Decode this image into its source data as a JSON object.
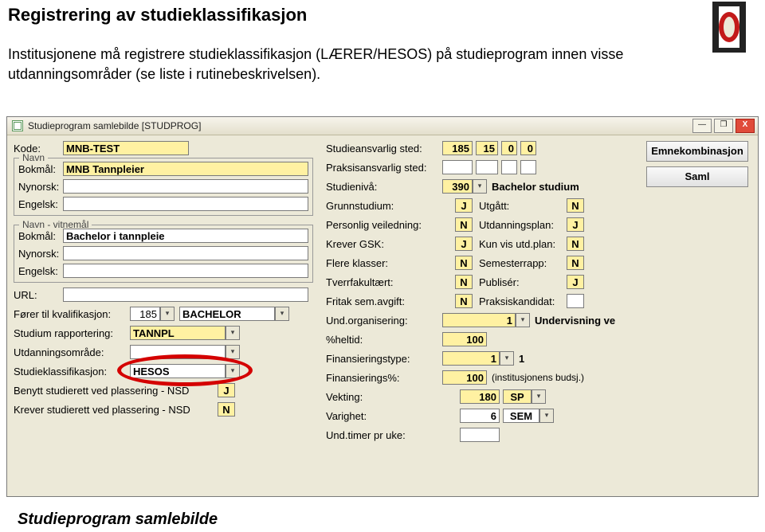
{
  "page": {
    "title": "Registrering av studieklassifikasjon",
    "intro": "Institusjonene må registrere studieklassifikasjon (LÆRER/HESOS) på studieprogram innen visse utdanningsområder (se liste i rutinebeskrivelsen).",
    "footer": "Studieprogram samlebilde"
  },
  "window": {
    "title": "Studieprogram samlebilde   [STUDPROG]",
    "controls": {
      "min": "—",
      "max": "❐",
      "close": "X"
    }
  },
  "left": {
    "kode": {
      "label": "Kode:",
      "value": "MNB-TEST"
    },
    "navn_legend": "Navn",
    "bokmal": {
      "label": "Bokmål:",
      "value": "MNB Tannpleier"
    },
    "nynorsk": {
      "label": "Nynorsk:",
      "value": ""
    },
    "engelsk": {
      "label": "Engelsk:",
      "value": ""
    },
    "vitnemal_legend": "Navn - vitnemål",
    "vitnemal_bokmal": {
      "label": "Bokmål:",
      "value": "Bachelor i tannpleie"
    },
    "vitnemal_nynorsk": {
      "label": "Nynorsk:",
      "value": ""
    },
    "vitnemal_engelsk": {
      "label": "Engelsk:",
      "value": ""
    },
    "url": {
      "label": "URL:",
      "value": ""
    },
    "kvalifikasjon": {
      "label": "Fører til kvalifikasjon:",
      "value": "185",
      "name": "BACHELOR"
    },
    "rapportering": {
      "label": "Studium rapportering:",
      "value": "TANNPL"
    },
    "utdanningsomrade": {
      "label": "Utdanningsområde:",
      "value": ""
    },
    "studieklassifikasjon": {
      "label": "Studieklassifikasjon:",
      "value": "HESOS"
    },
    "benytt_nsd": {
      "label": "Benytt studierett ved plassering - NSD",
      "value": "J"
    },
    "krever_nsd": {
      "label": "Krever studierett ved plassering - NSD",
      "value": "N"
    }
  },
  "mid": {
    "studieansvarlig": {
      "label": "Studieansvarlig sted:",
      "v1": "185",
      "v2": "15",
      "v3": "0",
      "v4": "0"
    },
    "praksisansvarlig": {
      "label": "Praksisansvarlig sted:",
      "v1": "",
      "v2": "",
      "v3": "",
      "v4": ""
    },
    "studieniva": {
      "label": "Studienivå:",
      "value": "390",
      "name": "Bachelor studium"
    },
    "grunnstudium": {
      "label": "Grunnstudium:",
      "value": "J"
    },
    "utgatt": {
      "label": "Utgått:",
      "value": "N"
    },
    "personlig": {
      "label": "Personlig veiledning:",
      "value": "N"
    },
    "utdanningsplan": {
      "label": "Utdanningsplan:",
      "value": "J"
    },
    "krever_gsk": {
      "label": "Krever GSK:",
      "value": "J"
    },
    "kun_vis": {
      "label": "Kun vis utd.plan:",
      "value": "N"
    },
    "flere_klasser": {
      "label": "Flere klasser:",
      "value": "N"
    },
    "semesterrapp": {
      "label": "Semesterrapp:",
      "value": "N"
    },
    "tverrfakultert": {
      "label": "Tverrfakultært:",
      "value": "N"
    },
    "publiser": {
      "label": "Publisér:",
      "value": "J"
    },
    "fritak": {
      "label": "Fritak sem.avgift:",
      "value": "N"
    },
    "praksiskandidat": {
      "label": "Praksiskandidat:",
      "value": ""
    },
    "und_org": {
      "label": "Und.organisering:",
      "value": "1",
      "name": "Undervisning ve"
    },
    "heltid": {
      "label": "%heltid:",
      "value": "100"
    },
    "finanstype": {
      "label": "Finansieringstype:",
      "value": "1",
      "extra": "1"
    },
    "finanspct": {
      "label": "Finansierings%:",
      "value": "100",
      "extra": "(institusjonens budsj.)"
    },
    "vekting": {
      "label": "Vekting:",
      "value": "180",
      "unit": "SP"
    },
    "varighet": {
      "label": "Varighet:",
      "value": "6",
      "unit": "SEM"
    },
    "und_timer": {
      "label": "Und.timer pr uke:",
      "value": ""
    }
  },
  "side": {
    "btn1": "Emnekombinasjon",
    "btn2": "Saml"
  }
}
